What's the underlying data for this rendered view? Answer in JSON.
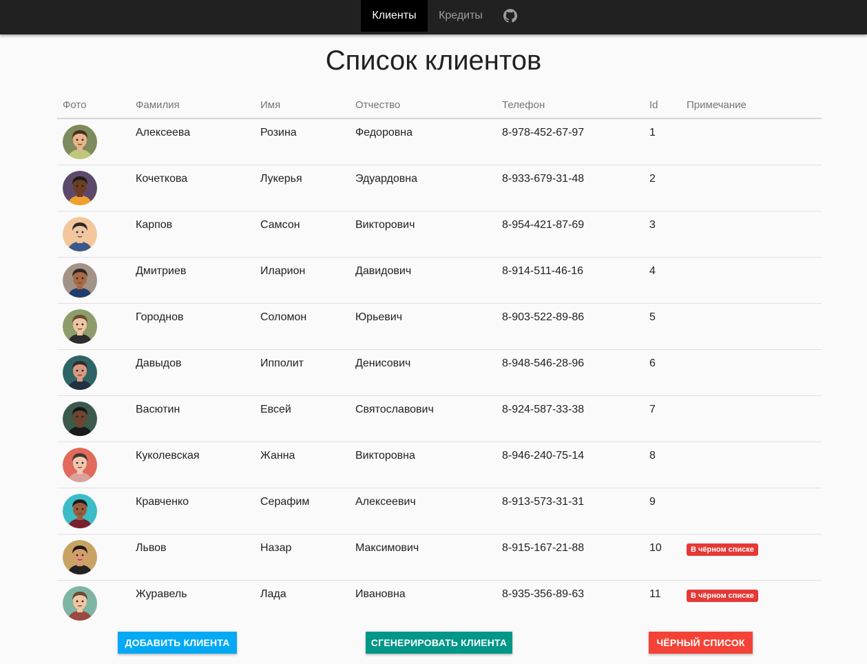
{
  "nav": {
    "clients": "Клиенты",
    "credits": "Кредиты",
    "github_icon": "github-icon"
  },
  "title": "Список клиентов",
  "table": {
    "columns": [
      "Фото",
      "Фамилия",
      "Имя",
      "Отчество",
      "Телефон",
      "Id",
      "Примечание"
    ],
    "rows": [
      {
        "last": "Алексеева",
        "first": "Розина",
        "middle": "Федоровна",
        "phone": "8-978-452-67-97",
        "id": "1",
        "note": ""
      },
      {
        "last": "Кочеткова",
        "first": "Лукерья",
        "middle": "Эдуардовна",
        "phone": "8-933-679-31-48",
        "id": "2",
        "note": ""
      },
      {
        "last": "Карпов",
        "first": "Самсон",
        "middle": "Викторович",
        "phone": "8-954-421-87-69",
        "id": "3",
        "note": ""
      },
      {
        "last": "Дмитриев",
        "first": "Иларион",
        "middle": "Давидович",
        "phone": "8-914-511-46-16",
        "id": "4",
        "note": ""
      },
      {
        "last": "Городнов",
        "first": "Соломон",
        "middle": "Юрьевич",
        "phone": "8-903-522-89-86",
        "id": "5",
        "note": ""
      },
      {
        "last": "Давыдов",
        "first": "Ипполит",
        "middle": "Денисович",
        "phone": "8-948-546-28-96",
        "id": "6",
        "note": ""
      },
      {
        "last": "Васютин",
        "first": "Евсей",
        "middle": "Святославович",
        "phone": "8-924-587-33-38",
        "id": "7",
        "note": ""
      },
      {
        "last": "Куколевская",
        "first": "Жанна",
        "middle": "Викторовна",
        "phone": "8-946-240-75-14",
        "id": "8",
        "note": ""
      },
      {
        "last": "Кравченко",
        "first": "Серафим",
        "middle": "Алексеевич",
        "phone": "8-913-573-31-31",
        "id": "9",
        "note": ""
      },
      {
        "last": "Львов",
        "first": "Назар",
        "middle": "Максимович",
        "phone": "8-915-167-21-88",
        "id": "10",
        "note": "В чёрном списке"
      },
      {
        "last": "Журавель",
        "first": "Лада",
        "middle": "Ивановна",
        "phone": "8-935-356-89-63",
        "id": "11",
        "note": "В чёрном списке"
      }
    ]
  },
  "buttons": {
    "add": "Добавить клиента",
    "generate": "Сгенерировать клиента",
    "blacklist": "Чёрный список"
  },
  "colors": {
    "navbar": "#212121",
    "btn_add": "#03a9f4",
    "btn_generate": "#009688",
    "btn_blacklist": "#f44336",
    "badge": "#e53935"
  }
}
